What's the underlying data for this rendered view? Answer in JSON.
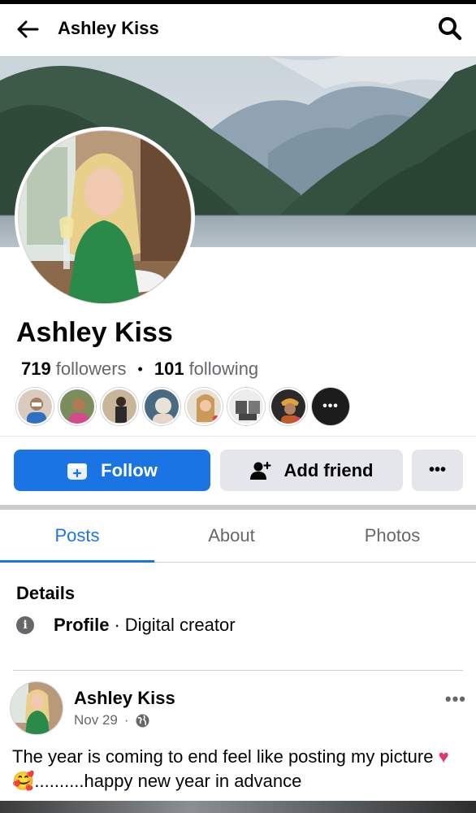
{
  "header": {
    "title": "Ashley Kiss",
    "back_icon": "arrow-left-icon",
    "search_icon": "search-icon"
  },
  "profile": {
    "name": "Ashley Kiss",
    "followers_count": "719",
    "followers_label": "followers",
    "following_count": "101",
    "following_label": "following",
    "follower_avatars_more": "•••"
  },
  "actions": {
    "follow_label": "Follow",
    "add_friend_label": "Add friend",
    "more_label": "•••"
  },
  "tabs": [
    {
      "label": "Posts",
      "active": true
    },
    {
      "label": "About",
      "active": false
    },
    {
      "label": "Photos",
      "active": false
    }
  ],
  "details": {
    "title": "Details",
    "profile_label": "Profile",
    "profile_separator": "·",
    "profile_value": "Digital creator",
    "info_icon": "info-icon"
  },
  "post": {
    "author": "Ashley Kiss",
    "date": "Nov 29",
    "meta_separator": "·",
    "privacy_icon": "globe-icon",
    "more_label": "•••",
    "text_part1": "The year is coming to end feel like posting my picture ",
    "emoji_heart": "♥",
    "emoji_face": "🥰",
    "text_part2": "..........happy new year in advance"
  },
  "colors": {
    "accent": "#1b74e4",
    "secondary_button": "#e4e6eb",
    "muted_text": "#65676b",
    "primary_text": "#050505"
  }
}
